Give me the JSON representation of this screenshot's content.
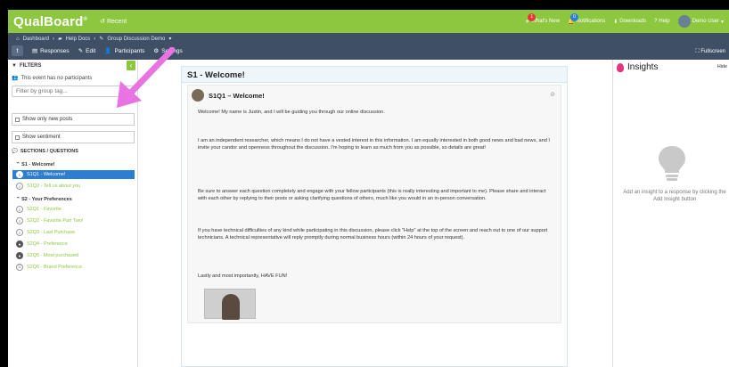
{
  "topbar": {
    "logo": "QualBoard",
    "logo_mark": "®",
    "recent": "Recent",
    "whats_new": "What's New",
    "whats_new_count": "1",
    "notifications": "Notifications",
    "notifications_count": "0",
    "downloads": "Downloads",
    "help": "Help",
    "user": "Demo User",
    "colors": {
      "bar": "#8dc63f",
      "badge_red": "#e53935",
      "badge_blue": "#2d7dd2"
    }
  },
  "nav": {
    "breadcrumb": [
      "Dashboard",
      "Help Docs",
      "Group Discussion Demo"
    ],
    "tabs": [
      "Responses",
      "Edit",
      "Participants",
      "Settings"
    ],
    "fullscreen": "Fullscreen",
    "color": "#3f4f66"
  },
  "filters": {
    "heading": "FILTERS",
    "no_participants": "This event has no participants",
    "group_placeholder": "Filter by group tag...",
    "show_new": "Show only new posts",
    "show_sentiment": "Show sentiment",
    "sections_heading": "SECTIONS / QUESTIONS",
    "sections": [
      {
        "label": "S1 - Welcome!",
        "questions": [
          {
            "label": "S1Q1 - Welcome!",
            "icon": "chat-icon",
            "selected": true
          },
          {
            "label": "S1Q2 - Tell us about you",
            "icon": "chat-icon",
            "selected": false
          }
        ]
      },
      {
        "label": "S2 - Your Preferences",
        "questions": [
          {
            "label": "S2Q1 - Favorite",
            "icon": "chat-icon",
            "selected": false
          },
          {
            "label": "S2Q2 - Favorite Part Two!",
            "icon": "chat-icon",
            "selected": false
          },
          {
            "label": "S2Q3 - Last Purchase",
            "icon": "chat-icon",
            "selected": false
          },
          {
            "label": "S2Q4 - Preference",
            "icon": "radio-icon",
            "selected": false
          },
          {
            "label": "S2Q5 - Most purchased",
            "icon": "radio-icon",
            "selected": false
          },
          {
            "label": "S2Q6 - Brand Preference",
            "icon": "list-icon",
            "selected": false
          }
        ]
      }
    ]
  },
  "main": {
    "section_title": "S1 - Welcome!",
    "post_title": "S1Q1 – Welcome!",
    "paragraphs": [
      "Welcome! My name is Justin, and I will be guiding you through our online discussion.",
      "I am an independent researcher, which means I do not have a vested interest in this information. I am equally interested in both good news and bad news, and I invite your candor and openness throughout the discussion. I'm hoping to learn as much from you as possible, so details are great!",
      "Be sure to answer each question completely and engage with your fellow participants (this is really interesting and important to me). Please share and interact with each other by replying to their posts or asking clarifying questions of others, much like you would in an in-person conversation.",
      "If you have technical difficulties of any kind while participating in this discussion, please click \"Help\" at the top of the screen and reach out to one of our support technicians. A technical representative will reply promptly during normal business hours (within 24 hours of your request).",
      "Lastly and most importantly, HAVE FUN!"
    ]
  },
  "insights": {
    "title": "Insights",
    "hide": "Hide",
    "empty_text": "Add an insight to a response by clicking the Add Insight button",
    "color": "#e6357a"
  },
  "annotation": {
    "arrow_color": "#e873e2"
  }
}
